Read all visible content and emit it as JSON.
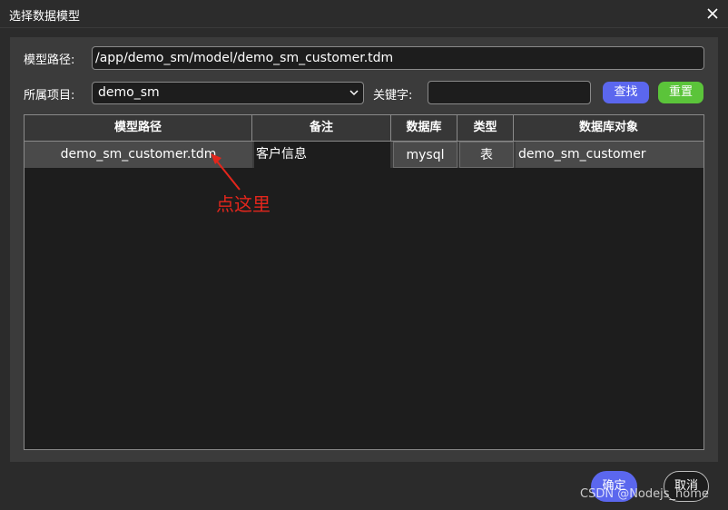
{
  "window": {
    "title": "选择数据模型"
  },
  "form": {
    "path_label": "模型路径:",
    "path_value": "/app/demo_sm/model/demo_sm_customer.tdm",
    "project_label": "所属项目:",
    "project_value": "demo_sm",
    "keyword_label": "关键字:",
    "keyword_value": "",
    "search_label": "查找",
    "reset_label": "重置"
  },
  "table": {
    "columns": [
      "模型路径",
      "备注",
      "数据库",
      "类型",
      "数据库对象"
    ],
    "rows": [
      [
        "demo_sm_customer.tdm",
        "客户信息",
        "mysql",
        "表",
        "demo_sm_customer"
      ]
    ]
  },
  "annotation": {
    "text": "点这里",
    "color": "#e3261c"
  },
  "footer": {
    "ok_label": "确定",
    "cancel_label": "取消"
  },
  "watermark": "CSDN @Nodejs_home",
  "colors": {
    "accent_blue": "#5b67ee",
    "accent_green": "#5bc43a",
    "background": "#2b2b2b",
    "panel": "#3b3b3b"
  },
  "icons": {
    "close": "close-icon",
    "dropdown": "chevron-down-icon"
  }
}
